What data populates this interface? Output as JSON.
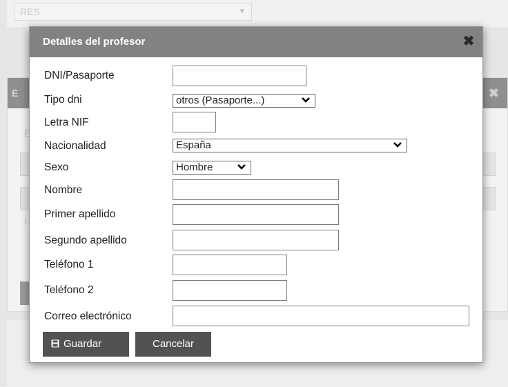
{
  "background": {
    "top_select_text": "RES",
    "panel_header_fragment": "E",
    "panel_text_fragments": [
      "E",
      "I"
    ]
  },
  "dialog": {
    "title": "Detalles del profesor",
    "close_symbol": "✖"
  },
  "form": {
    "dni_label": "DNI/Pasaporte",
    "dni_value": "",
    "tipo_dni_label": "Tipo dni",
    "tipo_dni_value": "otros (Pasaporte...)",
    "letra_nif_label": "Letra NIF",
    "letra_nif_value": "",
    "nacionalidad_label": "Nacionalidad",
    "nacionalidad_value": "España",
    "sexo_label": "Sexo",
    "sexo_value": "Hombre",
    "nombre_label": "Nombre",
    "nombre_value": "",
    "primer_apellido_label": "Primer apellido",
    "primer_apellido_value": "",
    "segundo_apellido_label": "Segundo apellido",
    "segundo_apellido_value": "",
    "telefono1_label": "Teléfono 1",
    "telefono1_value": "",
    "telefono2_label": "Teléfono 2",
    "telefono2_value": "",
    "correo_label": "Correo electrónico",
    "correo_value": ""
  },
  "buttons": {
    "save_label": "Guardar",
    "save_icon": "floppy-disk-icon",
    "cancel_label": "Cancelar"
  },
  "colors": {
    "header_bg": "#828282",
    "button_bg": "#525252",
    "overlay_bg": "#e6e6e6"
  }
}
